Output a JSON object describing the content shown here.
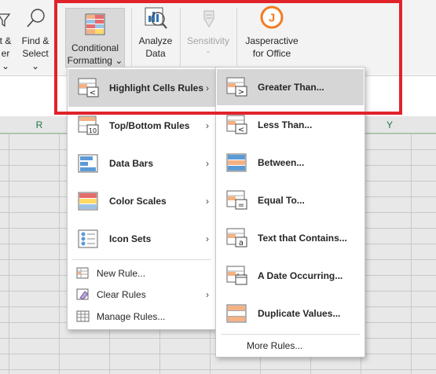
{
  "ribbon": {
    "buttons": [
      {
        "id": "sort-filter",
        "label1": "t &",
        "label2": "er",
        "caret": "⌄"
      },
      {
        "id": "find-select",
        "label1": "Find &",
        "label2": "Select",
        "caret": "⌄"
      },
      {
        "id": "conditional-formatting",
        "label1": "Conditional",
        "label2": "Formatting",
        "caret": "⌄"
      },
      {
        "id": "analyze-data",
        "label1": "Analyze",
        "label2": "Data"
      },
      {
        "id": "sensitivity",
        "label1": "Sensitivity",
        "caret": "⌄"
      },
      {
        "id": "jasperactive",
        "label1": "Jasperactive",
        "label2": "for Office",
        "logo_letter": "J"
      }
    ]
  },
  "column_headers": [
    "R",
    "Y"
  ],
  "main_menu": {
    "items": [
      {
        "label": "Highlight Cells Rules",
        "arrow": "›"
      },
      {
        "label": "Top/Bottom Rules",
        "arrow": "›"
      },
      {
        "label": "Data Bars",
        "arrow": "›"
      },
      {
        "label": "Color Scales",
        "arrow": "›"
      },
      {
        "label": "Icon Sets",
        "arrow": "›"
      },
      {
        "label": "New Rule..."
      },
      {
        "label": "Clear Rules",
        "arrow": "›"
      },
      {
        "label": "Manage Rules..."
      }
    ]
  },
  "sub_menu": {
    "items": [
      {
        "label": "Greater Than..."
      },
      {
        "label": "Less Than..."
      },
      {
        "label": "Between..."
      },
      {
        "label": "Equal To..."
      },
      {
        "label": "Text that Contains..."
      },
      {
        "label": "A Date Occurring..."
      },
      {
        "label": "Duplicate Values..."
      },
      {
        "label": "More Rules..."
      }
    ]
  },
  "colors": {
    "highlight_border": "#e0232b",
    "excel_green": "#217346",
    "jasper_orange": "#f47b20",
    "menu_hover": "#d6d6d6"
  }
}
